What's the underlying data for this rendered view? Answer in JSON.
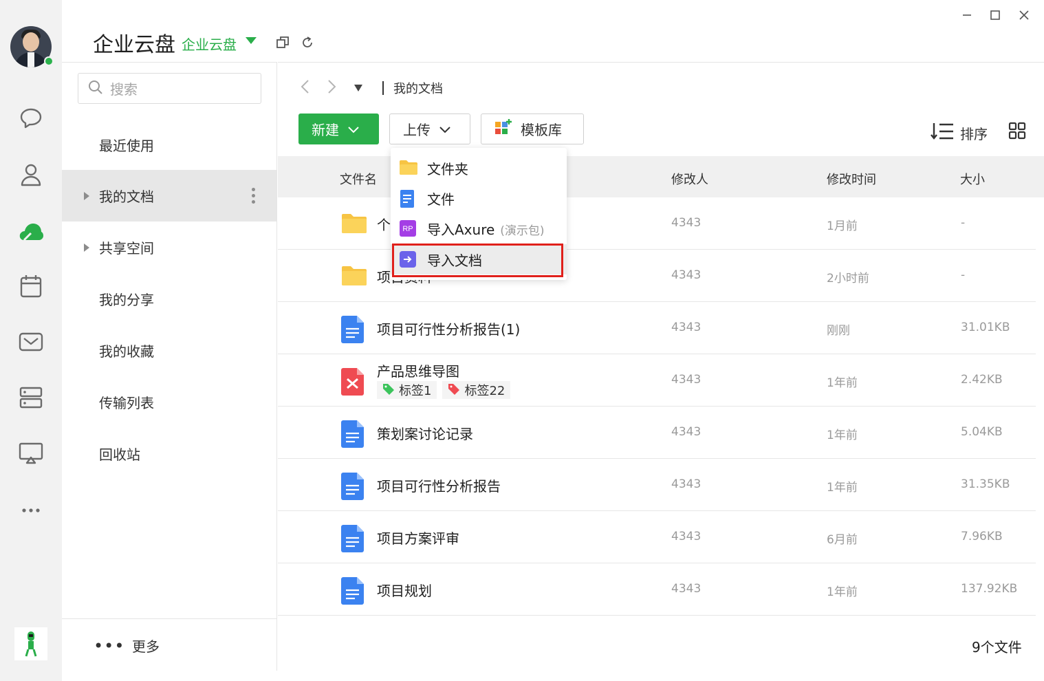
{
  "app": {
    "title": "企业云盘",
    "workspace": "企业云盘"
  },
  "rail": {
    "icons": [
      "chat-icon",
      "contacts-icon",
      "cloud-drive-icon",
      "calendar-icon",
      "mail-icon",
      "storage-icon",
      "screen-share-icon",
      "more-icon"
    ],
    "accent": "#2aae4a"
  },
  "sidebar": {
    "search_placeholder": "搜索",
    "items": [
      {
        "label": "最近使用"
      },
      {
        "label": "我的文档"
      },
      {
        "label": "共享空间"
      },
      {
        "label": "我的分享"
      },
      {
        "label": "我的收藏"
      },
      {
        "label": "传输列表"
      },
      {
        "label": "回收站"
      }
    ],
    "more_label": "更多"
  },
  "main": {
    "breadcrumb": "我的文档",
    "toolbar": {
      "new_label": "新建",
      "upload_label": "上传",
      "template_label": "模板库",
      "sort_label": "排序"
    },
    "columns": {
      "name": "文件名",
      "modifier": "修改人",
      "modified": "修改时间",
      "size": "大小"
    },
    "rows": [
      {
        "name": "个",
        "modifier": "4343",
        "modified": "1月前",
        "size": "-",
        "type": "folder"
      },
      {
        "name": "项目资料",
        "modifier": "4343",
        "modified": "2小时前",
        "size": "-",
        "type": "folder"
      },
      {
        "name": "项目可行性分析报告(1)",
        "modifier": "4343",
        "modified": "刚刚",
        "size": "31.01KB",
        "type": "doc"
      },
      {
        "name": "产品思维导图",
        "modifier": "4343",
        "modified": "1年前",
        "size": "2.42KB",
        "type": "mindmap",
        "tags": [
          "标签1",
          "标签22"
        ]
      },
      {
        "name": "策划案讨论记录",
        "modifier": "4343",
        "modified": "1年前",
        "size": "5.04KB",
        "type": "doc"
      },
      {
        "name": "项目可行性分析报告",
        "modifier": "4343",
        "modified": "1年前",
        "size": "31.35KB",
        "type": "doc"
      },
      {
        "name": "项目方案评审",
        "modifier": "4343",
        "modified": "6月前",
        "size": "7.96KB",
        "type": "doc"
      },
      {
        "name": "项目规划",
        "modifier": "4343",
        "modified": "1年前",
        "size": "137.92KB",
        "type": "doc"
      }
    ],
    "file_count": "9个文件"
  },
  "upload_menu": {
    "items": [
      {
        "label": "文件夹",
        "icon": "folder-icon"
      },
      {
        "label": "文件",
        "icon": "file-icon"
      },
      {
        "label": "导入Axure",
        "note": "(演示包)",
        "icon": "axure-rp-icon"
      },
      {
        "label": "导入文档",
        "icon": "import-doc-icon"
      }
    ],
    "highlighted": "导入文档"
  }
}
